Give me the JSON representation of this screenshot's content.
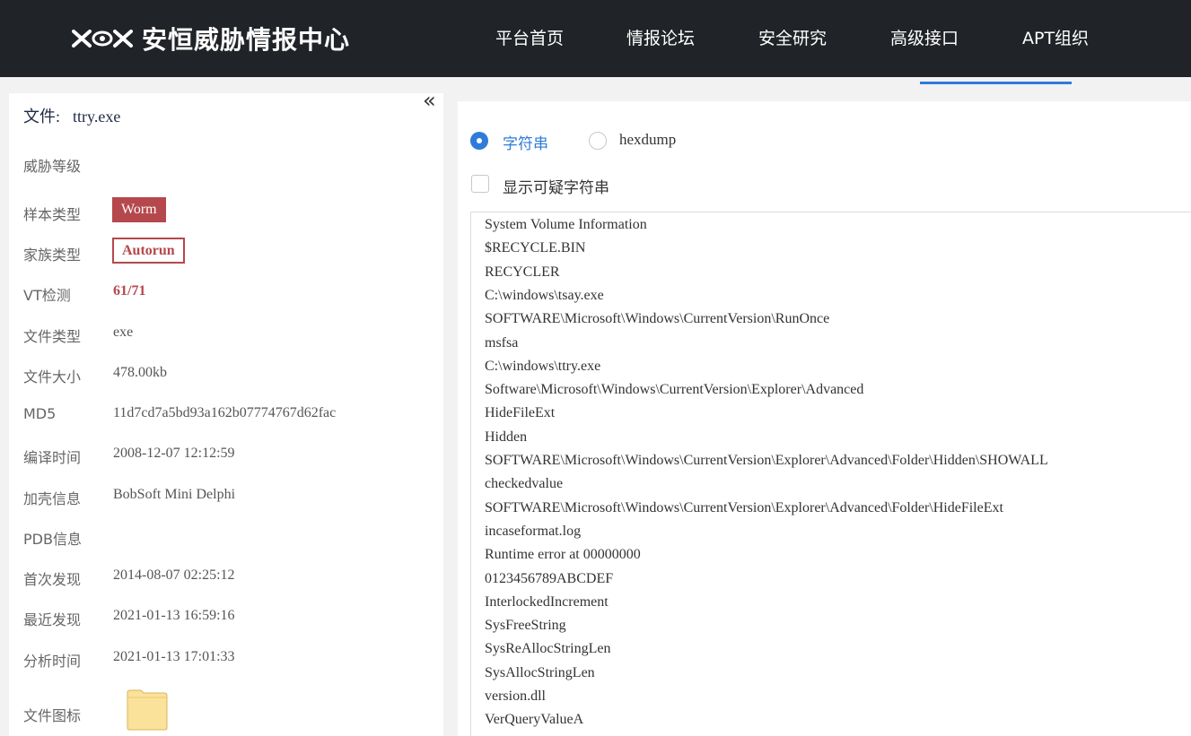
{
  "header": {
    "brand_name": "安恒威胁情报中心",
    "nav": [
      "平台首页",
      "情报论坛",
      "安全研究",
      "高级接口",
      "APT组织"
    ]
  },
  "file_info": {
    "file_label": "文件:",
    "file_name": "ttry.exe",
    "collapse_glyph": "«",
    "rows": [
      {
        "label": "威胁等级",
        "value": ""
      },
      {
        "label": "样本类型",
        "value": "Worm"
      },
      {
        "label": "家族类型",
        "value": "Autorun"
      },
      {
        "label": "VT检测",
        "value": "61/71"
      },
      {
        "label": "文件类型",
        "value": "exe"
      },
      {
        "label": "文件大小",
        "value": "478.00kb"
      },
      {
        "label": "MD5",
        "value": "11d7cd7a5bd93a162b07774767d62fac"
      },
      {
        "label": "编译时间",
        "value": "2008-12-07 12:12:59"
      },
      {
        "label": "加壳信息",
        "value": "BobSoft Mini Delphi"
      },
      {
        "label": "PDB信息",
        "value": ""
      },
      {
        "label": "首次发现",
        "value": "2014-08-07 02:25:12"
      },
      {
        "label": "最近发现",
        "value": "2021-01-13 16:59:16"
      },
      {
        "label": "分析时间",
        "value": "2021-01-13 17:01:33"
      },
      {
        "label": "文件图标",
        "value": ""
      }
    ],
    "icon": "folder-icon"
  },
  "strings_view": {
    "mode_options": [
      {
        "label": "字符串",
        "selected": true
      },
      {
        "label": "hexdump",
        "selected": false
      }
    ],
    "suspicious_checkbox": {
      "label": "显示可疑字符串",
      "checked": false
    },
    "lines": [
      "System Volume Information",
      "$RECYCLE.BIN",
      "RECYCLER",
      "C:\\windows\\tsay.exe",
      "SOFTWARE\\Microsoft\\Windows\\CurrentVersion\\RunOnce",
      "msfsa",
      "C:\\windows\\ttry.exe",
      "Software\\Microsoft\\Windows\\CurrentVersion\\Explorer\\Advanced",
      "HideFileExt",
      "Hidden",
      "SOFTWARE\\Microsoft\\Windows\\CurrentVersion\\Explorer\\Advanced\\Folder\\Hidden\\SHOWALL",
      "checkedvalue",
      "SOFTWARE\\Microsoft\\Windows\\CurrentVersion\\Explorer\\Advanced\\Folder\\HideFileExt",
      "incaseformat.log",
      "Runtime error at 00000000",
      "0123456789ABCDEF",
      "InterlockedIncrement",
      "SysFreeString",
      "SysReAllocStringLen",
      "SysAllocStringLen",
      "version.dll",
      "VerQueryValueA"
    ]
  },
  "colors": {
    "header_bg": "#202327",
    "accent_blue": "#2f7bd9",
    "threat_red": "#b5484c"
  }
}
